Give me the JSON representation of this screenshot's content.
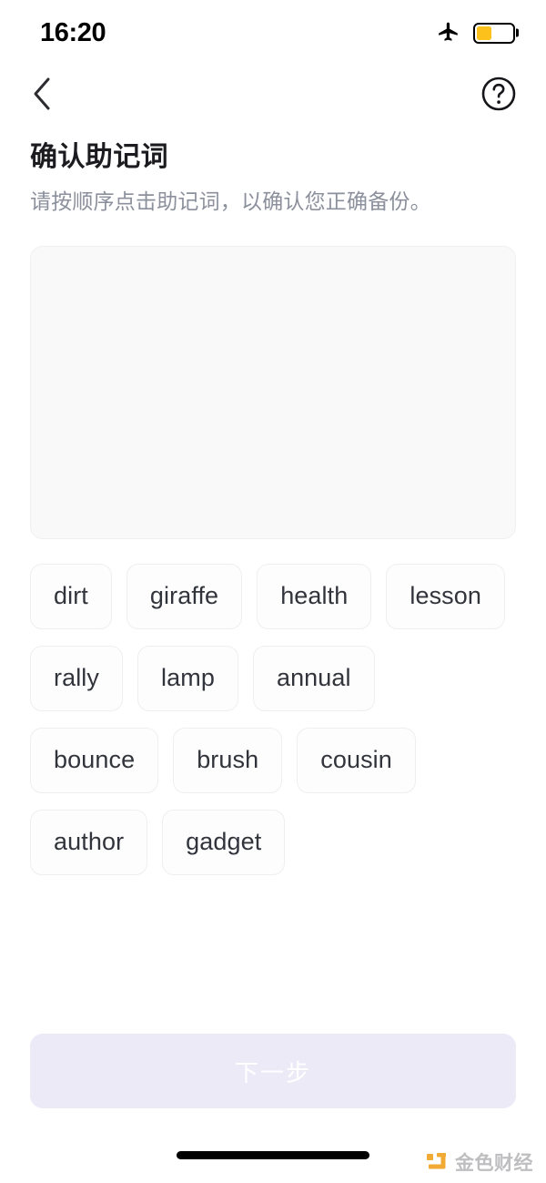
{
  "status_bar": {
    "time": "16:20",
    "airplane_icon": "airplane-mode-icon",
    "battery_icon": "battery-icon",
    "battery_level_percent": 42,
    "battery_color": "#fcc21b"
  },
  "nav_bar": {
    "back_icon": "chevron-left-icon",
    "help_icon": "question-mark-circle-icon"
  },
  "header": {
    "title": "确认助记词",
    "subtitle": "请按顺序点击助记词，以确认您正确备份。"
  },
  "drop_zone": {
    "name": "selected-words-area",
    "selected_words": [],
    "background_color": "#f9f9fa"
  },
  "word_bank": {
    "words": [
      "dirt",
      "giraffe",
      "health",
      "lesson",
      "rally",
      "lamp",
      "annual",
      "bounce",
      "brush",
      "cousin",
      "author",
      "gadget"
    ]
  },
  "footer": {
    "next_label": "下一步",
    "next_disabled": true,
    "next_bg_color": "#eceaf7",
    "next_text_color": "#ffffff"
  },
  "watermark": {
    "text": "金色财经",
    "logo_color": "#f0a322"
  }
}
